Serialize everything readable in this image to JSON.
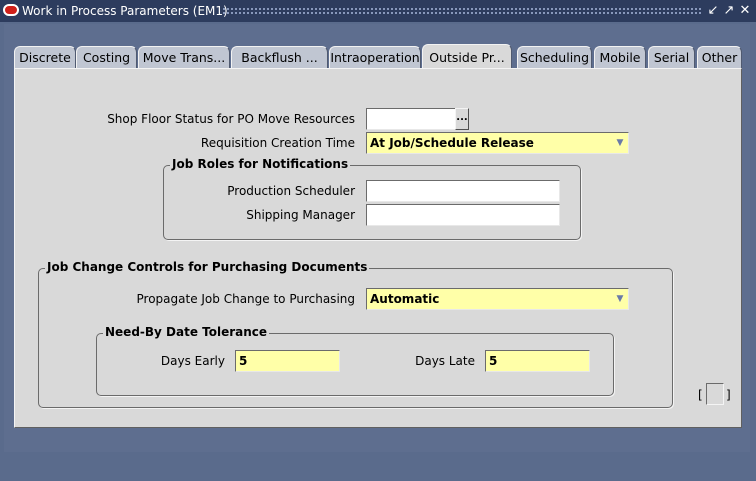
{
  "window": {
    "title": "Work in Process Parameters (EM1)",
    "buttons": [
      "↙",
      "↗",
      "✕"
    ]
  },
  "tabs": [
    {
      "label": "Discrete",
      "active": false
    },
    {
      "label": "Costing",
      "active": false
    },
    {
      "label": "Move Trans...",
      "active": false
    },
    {
      "label": "Backflush ...",
      "active": false
    },
    {
      "label": "Intraoperation",
      "active": false
    },
    {
      "label": "Outside Pr...",
      "active": true
    },
    {
      "label": "Scheduling",
      "active": false
    },
    {
      "label": "Mobile",
      "active": false
    },
    {
      "label": "Serial",
      "active": false
    },
    {
      "label": "Other",
      "active": false
    }
  ],
  "form": {
    "shop_floor_label": "Shop Floor Status for PO Move Resources",
    "shop_floor_value": "",
    "lov_button": "...",
    "req_creation_label": "Requisition Creation Time",
    "req_creation_value": "At Job/Schedule Release",
    "job_roles_title": "Job Roles for Notifications",
    "production_scheduler_label": "Production Scheduler",
    "production_scheduler_value": "",
    "shipping_manager_label": "Shipping Manager",
    "shipping_manager_value": "",
    "job_change_title": "Job Change Controls for Purchasing Documents",
    "propagate_label": "Propagate Job Change to Purchasing",
    "propagate_value": "Automatic",
    "need_by_title": "Need-By Date Tolerance",
    "days_early_label": "Days Early",
    "days_early_value": "5",
    "days_late_label": "Days Late",
    "days_late_value": "5",
    "dropdown_arrow": "▼",
    "bracket_left": "[",
    "bracket_right": "]"
  }
}
